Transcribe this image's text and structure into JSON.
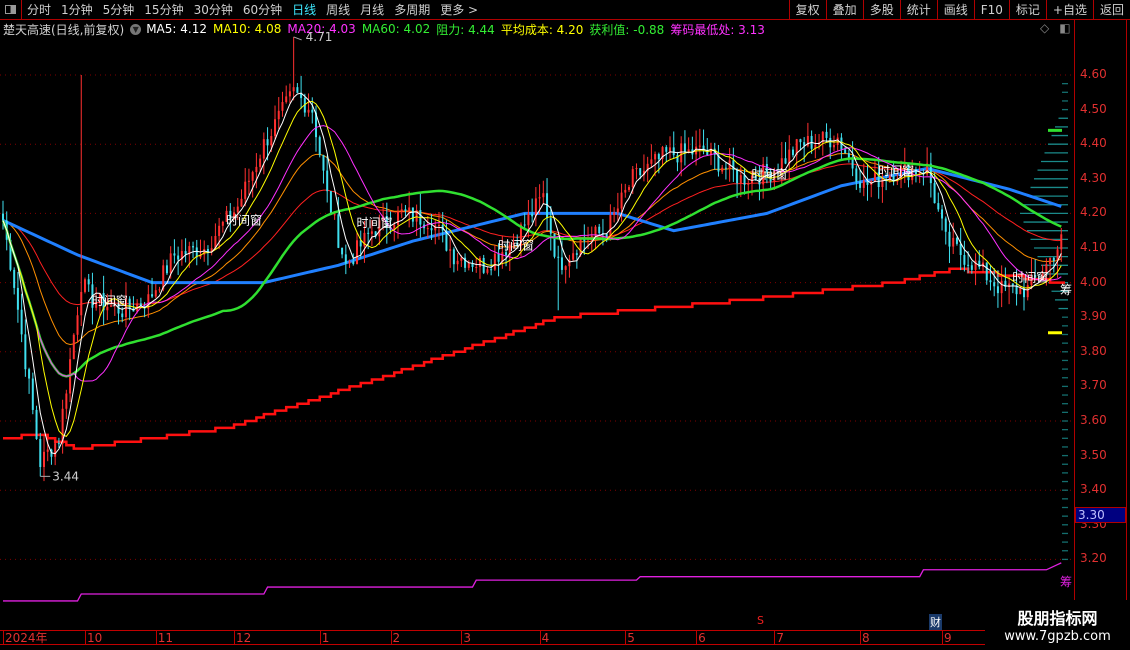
{
  "topbar": {
    "periods": [
      "分时",
      "1分钟",
      "5分钟",
      "15分钟",
      "30分钟",
      "60分钟",
      "日线",
      "周线",
      "月线",
      "多周期",
      "更多 >"
    ],
    "active": "日线",
    "buttons": [
      "复权",
      "叠加",
      "多股",
      "统计",
      "画线",
      "F10",
      "标记",
      "+自选",
      "返回"
    ]
  },
  "legend": {
    "name": "楚天高速(日线,前复权)",
    "ma5": "MA5: 4.12",
    "ma10": "MA10: 4.08",
    "ma20": "MA20: 4.03",
    "ma60": "MA60: 4.02",
    "resist": "阻力: 4.44",
    "avgcost": "平均成本: 4.20",
    "profit": "获利值: -0.88",
    "chiplow": "筹码最低处: 3.13"
  },
  "colors": {
    "up": "#ff3030",
    "down": "#40e0f0",
    "ma5": "#ffffff",
    "ma10": "#ffff00",
    "ma20": "#ff30ff",
    "ma60": "#30e030",
    "long": "#2080ff",
    "cost": "#ff1010",
    "chip": "#e020e0",
    "axis": "#e03030"
  },
  "chart_data": {
    "type": "candlestick",
    "y_ticks": [
      "4.60",
      "4.50",
      "4.40",
      "4.30",
      "4.20",
      "4.10",
      "4.00",
      "3.90",
      "3.80",
      "3.70",
      "3.60",
      "3.50",
      "3.40",
      "3.30",
      "3.20"
    ],
    "ylim": [
      3.13,
      4.74
    ],
    "days": 285,
    "close_keypoints": [
      [
        0,
        4.18
      ],
      [
        3,
        4.0
      ],
      [
        7,
        3.7
      ],
      [
        10,
        3.48
      ],
      [
        15,
        3.55
      ],
      [
        19,
        3.85
      ],
      [
        21,
        4.0
      ],
      [
        24,
        3.95
      ],
      [
        32,
        3.92
      ],
      [
        39,
        3.95
      ],
      [
        46,
        4.08
      ],
      [
        54,
        4.1
      ],
      [
        63,
        4.22
      ],
      [
        70,
        4.4
      ],
      [
        78,
        4.55
      ],
      [
        83,
        4.5
      ],
      [
        87,
        4.25
      ],
      [
        92,
        4.05
      ],
      [
        99,
        4.15
      ],
      [
        107,
        4.2
      ],
      [
        115,
        4.18
      ],
      [
        121,
        4.08
      ],
      [
        129,
        4.05
      ],
      [
        137,
        4.12
      ],
      [
        145,
        4.25
      ],
      [
        149,
        4.05
      ],
      [
        155,
        4.12
      ],
      [
        162,
        4.15
      ],
      [
        169,
        4.3
      ],
      [
        178,
        4.37
      ],
      [
        188,
        4.38
      ],
      [
        198,
        4.3
      ],
      [
        206,
        4.32
      ],
      [
        214,
        4.4
      ],
      [
        224,
        4.42
      ],
      [
        231,
        4.28
      ],
      [
        239,
        4.32
      ],
      [
        248,
        4.33
      ],
      [
        253,
        4.12
      ],
      [
        261,
        4.05
      ],
      [
        268,
        3.98
      ],
      [
        275,
        3.98
      ],
      [
        280,
        4.05
      ],
      [
        284,
        4.12
      ]
    ],
    "extremes": {
      "high": {
        "day": 78,
        "value": 4.71,
        "label": "4.71"
      },
      "low": {
        "day": 10,
        "value": 3.44,
        "label": "3.44"
      }
    },
    "long_ma_keypoints": [
      [
        0,
        4.18
      ],
      [
        20,
        4.08
      ],
      [
        40,
        4.0
      ],
      [
        70,
        4.0
      ],
      [
        90,
        4.05
      ],
      [
        110,
        4.12
      ],
      [
        140,
        4.2
      ],
      [
        165,
        4.2
      ],
      [
        180,
        4.15
      ],
      [
        205,
        4.2
      ],
      [
        225,
        4.28
      ],
      [
        248,
        4.33
      ],
      [
        270,
        4.27
      ],
      [
        284,
        4.22
      ]
    ],
    "cost_line_keypoints": [
      [
        0,
        3.55
      ],
      [
        10,
        3.56
      ],
      [
        20,
        3.52
      ],
      [
        60,
        3.58
      ],
      [
        100,
        3.72
      ],
      [
        149,
        3.9
      ],
      [
        200,
        3.95
      ],
      [
        240,
        4.0
      ],
      [
        255,
        4.04
      ],
      [
        270,
        4.02
      ],
      [
        284,
        4.0
      ]
    ],
    "chip_low_keypoints": [
      [
        0,
        3.08
      ],
      [
        20,
        3.08
      ],
      [
        21,
        3.1
      ],
      [
        70,
        3.1
      ],
      [
        71,
        3.12
      ],
      [
        126,
        3.12
      ],
      [
        127,
        3.14
      ],
      [
        170,
        3.14
      ],
      [
        171,
        3.15
      ],
      [
        246,
        3.15
      ],
      [
        247,
        3.17
      ],
      [
        280,
        3.17
      ],
      [
        284,
        3.19
      ]
    ],
    "time_window_label": "时间窗",
    "time_window_days": [
      26,
      62,
      97,
      135,
      203,
      237,
      273
    ],
    "chip_label": "筹",
    "current_price_tag": "3.30",
    "months": [
      {
        "label": "2024年",
        "day": 0
      },
      {
        "label": "10",
        "day": 22
      },
      {
        "label": "11",
        "day": 41
      },
      {
        "label": "12",
        "day": 62
      },
      {
        "label": "1",
        "day": 85
      },
      {
        "label": "2",
        "day": 104
      },
      {
        "label": "3",
        "day": 123
      },
      {
        "label": "4",
        "day": 144
      },
      {
        "label": "5",
        "day": 167
      },
      {
        "label": "6",
        "day": 186
      },
      {
        "label": "7",
        "day": 207
      },
      {
        "label": "8",
        "day": 230
      },
      {
        "label": "9",
        "day": 252
      }
    ],
    "markers": {
      "s": "S",
      "cai": "财"
    }
  },
  "watermark": {
    "title": "股朋指标网",
    "url": "www.7gpzb.com"
  }
}
